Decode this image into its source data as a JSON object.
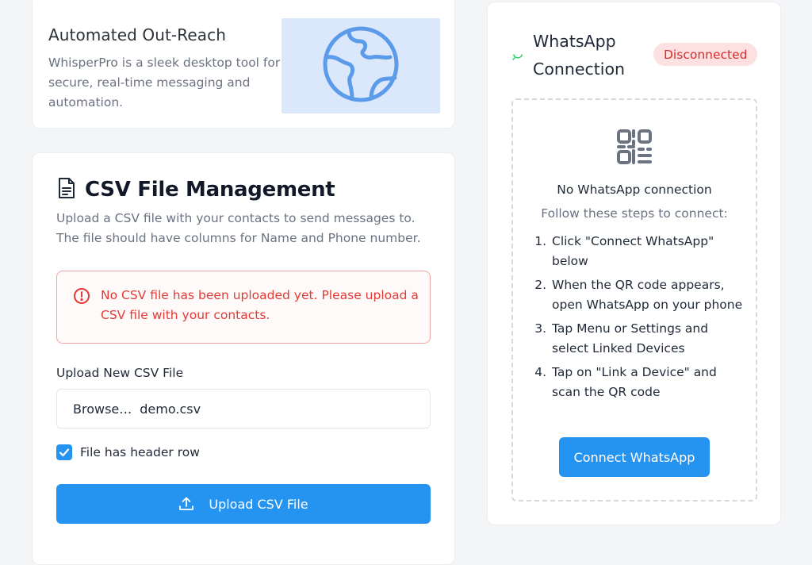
{
  "promo": {
    "title": "Automated Out-Reach",
    "description": "WhisperPro is a sleek desktop tool for secure, real-time messaging and automation.",
    "image_icon": "globe-icon",
    "image_bg": "#dbe8fb",
    "icon_color": "#5b9bea"
  },
  "csv": {
    "icon": "document-icon",
    "title": "CSV File Management",
    "description": "Upload a CSV file with your contacts to send messages to. The file should have columns for Name and Phone number.",
    "alert": {
      "icon": "alert-circle-icon",
      "text": "No CSV file has been uploaded yet. Please upload a CSV file with your contacts.",
      "color": "#e53935"
    },
    "upload_label": "Upload New CSV File",
    "file_input": {
      "browse_label": "Browse…",
      "file_name": "demo.csv"
    },
    "header_checkbox": {
      "label": "File has header row",
      "checked": true
    },
    "upload_button": {
      "icon": "upload-icon",
      "label": "Upload CSV File"
    }
  },
  "whatsapp": {
    "logo_icon": "whatsapp-icon",
    "title": "WhatsApp Connection",
    "status_badge": "Disconnected",
    "qr_icon": "qr-code-icon",
    "no_connection": "No WhatsApp connection",
    "follow_steps": "Follow these steps to connect:",
    "steps": [
      {
        "num": "1.",
        "text": "Click \"Connect WhatsApp\" below"
      },
      {
        "num": "2.",
        "text": "When the QR code appears, open WhatsApp on your phone"
      },
      {
        "num": "3.",
        "text": "Tap Menu or Settings and select Linked Devices"
      },
      {
        "num": "4.",
        "text": "Tap on \"Link a Device\" and scan the QR code"
      }
    ],
    "connect_button": "Connect WhatsApp"
  },
  "colors": {
    "accent": "#2593f0",
    "danger": "#e53935",
    "badge_bg": "#fde0e0",
    "whatsapp_green": "#25d366"
  }
}
